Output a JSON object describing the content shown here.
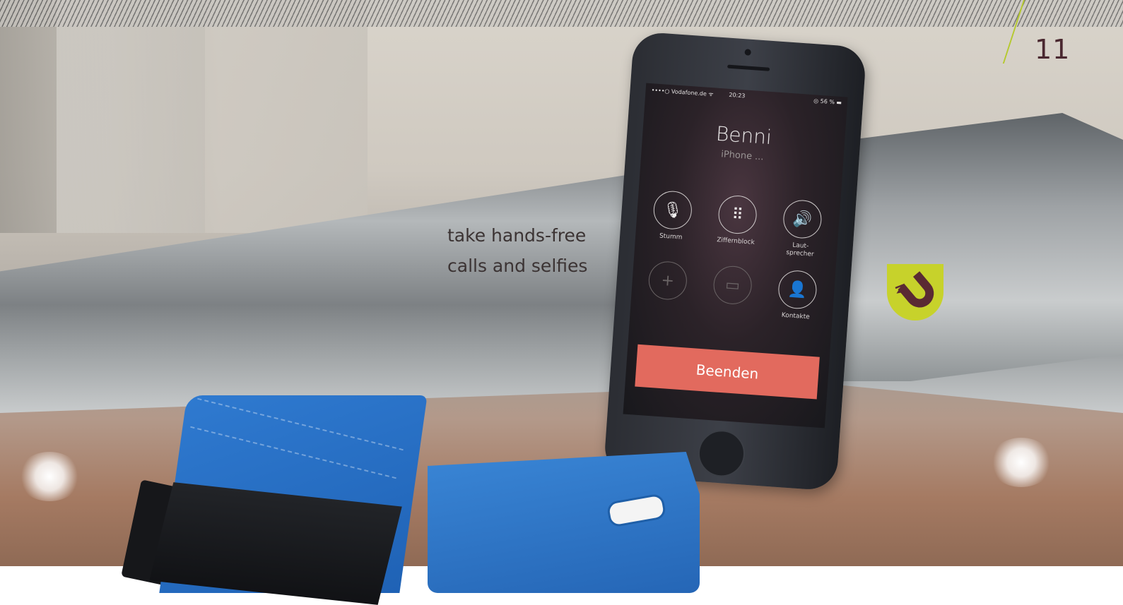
{
  "header": {
    "page_number": "11"
  },
  "tagline": {
    "line1": "take hands-free",
    "line2": "calls and selfies"
  },
  "phone": {
    "status": {
      "carrier": "••••○ Vodafone.de ᯤ",
      "time": "20:23",
      "battery": "◎ 56 % ▬"
    },
    "caller": {
      "name": "Benni",
      "subtitle": "iPhone ..."
    },
    "buttons": [
      {
        "label": "Stumm",
        "icon": "microphone-mute-icon",
        "glyph": "🎙"
      },
      {
        "label": "Ziffernblock",
        "icon": "keypad-icon",
        "glyph": "⠿"
      },
      {
        "label": "Laut-\nsprecher",
        "icon": "speaker-icon",
        "glyph": "🔊"
      },
      {
        "label": "",
        "icon": "add-call-icon",
        "glyph": "+"
      },
      {
        "label": "",
        "icon": "facetime-icon",
        "glyph": "▭"
      },
      {
        "label": "Kontakte",
        "icon": "contacts-icon",
        "glyph": "👤"
      }
    ],
    "end_button": "Beenden"
  },
  "badge": {
    "icon": "magnet-icon",
    "color": "#c7d22b",
    "magnet_color": "#5a2a33"
  },
  "colors": {
    "accent_green": "#b5c92e",
    "end_red": "#e26a5e",
    "wallet_blue": "#2a72c6"
  }
}
